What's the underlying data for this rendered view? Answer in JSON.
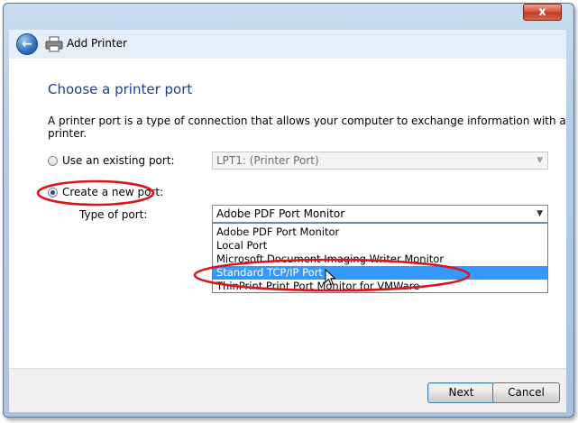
{
  "window": {
    "title": "Add Printer",
    "close_label": "x"
  },
  "page": {
    "heading": "Choose a printer port",
    "description": "A printer port is a type of connection that allows your computer to exchange information with a printer."
  },
  "options": {
    "existing_label": "Use an existing port:",
    "existing_value": "LPT1: (Printer Port)",
    "new_label": "Create a new port:",
    "type_label": "Type of port:",
    "type_value": "Adobe PDF Port Monitor"
  },
  "port_list": [
    "Adobe PDF Port Monitor",
    "Local Port",
    "Microsoft Document Imaging Writer Monitor",
    "Standard TCP/IP Port",
    "ThinPrint Print Port Monitor for VMWare"
  ],
  "selected_index": 3,
  "buttons": {
    "next": "Next",
    "cancel": "Cancel"
  },
  "icons": {
    "back": "back-arrow-icon",
    "printer": "printer-icon",
    "dropdown": "chevron-down-icon",
    "cursor": "mouse-pointer-icon"
  },
  "colors": {
    "heading": "#1f3f8f",
    "selection": "#3399ff",
    "annotation": "#d9161c"
  }
}
